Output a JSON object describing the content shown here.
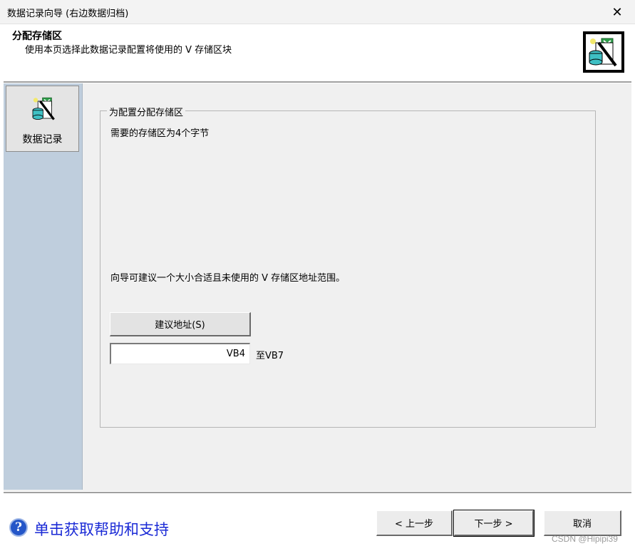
{
  "window": {
    "title": "数据记录向导 (右边数据归档)",
    "close_glyph": "✕"
  },
  "header": {
    "title": "分配存储区",
    "description": "使用本页选择此数据记录配置将使用的 V 存储区块",
    "icon": "data-log-wizard-icon"
  },
  "sidebar": {
    "items": [
      {
        "label": "数据记录",
        "icon": "data-log-icon"
      }
    ]
  },
  "group": {
    "legend": "为配置分配存储区",
    "required_text": "需要的存储区为4个字节",
    "suggest_text": "向导可建议一个大小合适且未使用的 V 存储区地址范围。",
    "suggest_button": "建议地址(S)",
    "address_start": "VB4",
    "address_end": "至VB7"
  },
  "footer": {
    "help_icon_glyph": "?",
    "help_link": "单击获取帮助和支持",
    "prev_button": "< 上一步",
    "next_button": "下一步 >",
    "cancel_button": "取消",
    "watermark": "CSDN @Hipipi39"
  },
  "colors": {
    "sidebar_bg": "#bfcedd",
    "help_link": "#1a2ad6",
    "panel_bg": "#f0f0f0"
  }
}
